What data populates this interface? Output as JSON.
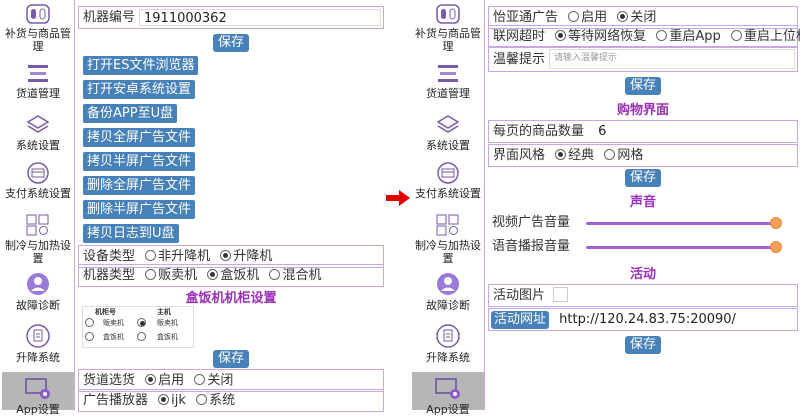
{
  "left": {
    "sidebar": [
      {
        "label": "补货与商品管理",
        "icon": "toggle-switch-icon"
      },
      {
        "label": "货道管理",
        "icon": "sliders-icon"
      },
      {
        "label": "系统设置",
        "icon": "layers-icon"
      },
      {
        "label": "支付系统设置",
        "icon": "credit-card-icon"
      },
      {
        "label": "制冷与加热设置",
        "icon": "grid-gear-icon"
      },
      {
        "label": "故障诊断",
        "icon": "user-circle-icon"
      },
      {
        "label": "升降系统",
        "icon": "document-icon"
      },
      {
        "label": "App设置",
        "icon": "monitor-gear-icon"
      }
    ],
    "machine_id_label": "机器编号",
    "machine_id_value": "1911000362",
    "save_label": "保存",
    "actions": [
      "打开ES文件浏览器",
      "打开安卓系统设置",
      "备份APP至U盘",
      "拷贝全屏广告文件",
      "拷贝半屏广告文件",
      "删除全屏广告文件",
      "删除半屏广告文件",
      "拷贝日志到U盘"
    ],
    "device_type": {
      "label": "设备类型",
      "options": [
        "非升降机",
        "升降机"
      ],
      "selected": 1
    },
    "machine_type": {
      "label": "机器类型",
      "options": [
        "贩卖机",
        "盒饭机",
        "混合机"
      ],
      "selected": 1
    },
    "cabinet_title": "盒饭机机柜设置",
    "cabinet_table": {
      "headers": [
        "机柜号",
        "主机"
      ],
      "rows": [
        [
          "贩卖机",
          "贩卖机"
        ],
        [
          "盒饭机",
          "盒饭机"
        ]
      ]
    },
    "save2_label": "保存",
    "lane_select": {
      "label": "货道选货",
      "options": [
        "启用",
        "关闭"
      ],
      "selected": 0
    },
    "ad_player": {
      "label": "广告播放器",
      "options": [
        "ijk",
        "系统"
      ],
      "selected": 0
    }
  },
  "right": {
    "sidebar": [
      {
        "label": "补货与商品管理",
        "icon": "toggle-switch-icon"
      },
      {
        "label": "货道管理",
        "icon": "sliders-icon"
      },
      {
        "label": "系统设置",
        "icon": "layers-icon"
      },
      {
        "label": "支付系统设置",
        "icon": "credit-card-icon"
      },
      {
        "label": "制冷与加热设置",
        "icon": "grid-gear-icon"
      },
      {
        "label": "故障诊断",
        "icon": "user-circle-icon"
      },
      {
        "label": "升降系统",
        "icon": "document-icon"
      },
      {
        "label": "App设置",
        "icon": "monitor-gear-icon"
      }
    ],
    "yiyatong": {
      "label": "怡亚通广告",
      "options": [
        "启用",
        "关闭"
      ],
      "selected": 1
    },
    "network_timeout": {
      "label": "联网超时",
      "options": [
        "等待网络恢复",
        "重启App",
        "重启上位机"
      ],
      "selected": 0
    },
    "tips": {
      "label": "温馨提示",
      "placeholder": "请输入温馨提示"
    },
    "save_label": "保存",
    "shopping_title": "购物界面",
    "goods_per_page": {
      "label": "每页的商品数量",
      "value": "6"
    },
    "ui_style": {
      "label": "界面风格",
      "options": [
        "经典",
        "网格"
      ],
      "selected": 0
    },
    "save2_label": "保存",
    "sound_title": "声音",
    "video_volume": {
      "label": "视频广告音量",
      "level": 1.0
    },
    "voice_volume": {
      "label": "语音播报音量",
      "level": 1.0
    },
    "activity_title": "活动",
    "activity_image": {
      "label": "活动图片",
      "checked": false
    },
    "activity_url": {
      "label": "活动网址",
      "value": "http://120.24.83.75:20090/"
    },
    "save3_label": "保存"
  },
  "colors": {
    "accent_button": "#4681b9",
    "section_title": "#9b30b8",
    "slider_track": "#9f5fd8",
    "slider_knob": "#f5a05a",
    "arrow": "#e00000",
    "border": "#c9a6e6"
  }
}
